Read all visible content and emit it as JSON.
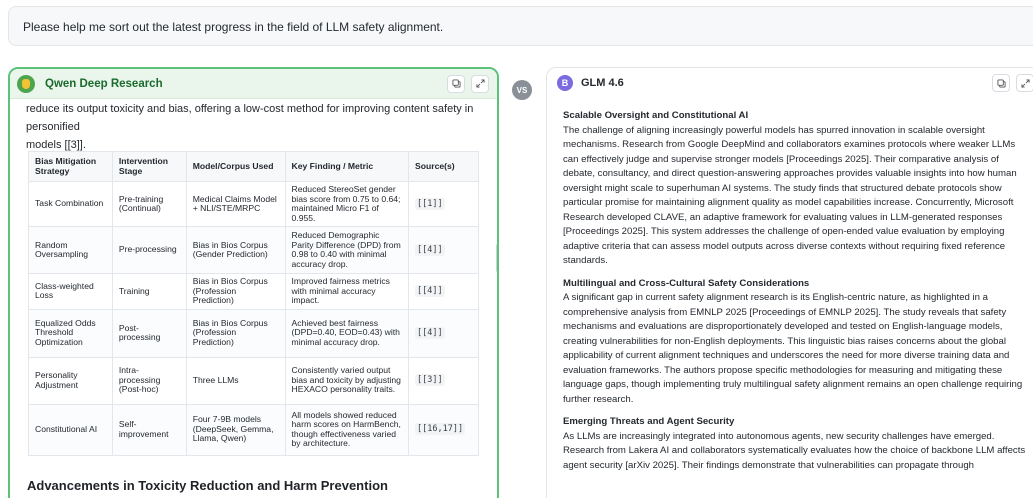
{
  "prompt": "Please help me sort out the latest progress in the field of LLM safety alignment.",
  "left": {
    "title": "Qwen Deep Research",
    "intro_line1": "reduce its output toxicity and bias, offering a low-cost method for improving content safety in personified",
    "intro_line2": "models [[3]].",
    "table": {
      "headers": [
        "Bias Mitigation Strategy",
        "Intervention Stage",
        "Model/Corpus Used",
        "Key Finding / Metric",
        "Source(s)"
      ],
      "rows": [
        [
          "Task Combination",
          "Pre-training (Continual)",
          "Medical Claims Model + NLI/STE/MRPC",
          "Reduced StereoSet gender bias score from 0.75 to 0.64; maintained Micro F1 of 0.955.",
          "[[1]]"
        ],
        [
          "Random Oversampling",
          "Pre-processing",
          "Bias in Bios Corpus (Gender Prediction)",
          "Reduced Demographic Parity Difference (DPD) from 0.98 to 0.40 with minimal accuracy drop.",
          "[[4]]"
        ],
        [
          "Class-weighted Loss",
          "Training",
          "Bias in Bios Corpus (Profession Prediction)",
          "Improved fairness metrics with minimal accuracy impact.",
          "[[4]]"
        ],
        [
          "Equalized Odds Threshold Optimization",
          "Post-processing",
          "Bias in Bios Corpus (Profession Prediction)",
          "Achieved best fairness (DPD=0.40, EOD=0.43) with minimal accuracy drop.",
          "[[4]]"
        ],
        [
          "Personality Adjustment",
          "Intra-processing (Post-hoc)",
          "Three LLMs",
          "Consistently varied output bias and toxicity by adjusting HEXACO personality traits.",
          "[[3]]"
        ],
        [
          "Constitutional AI",
          "Self-improvement",
          "Four 7-9B models (DeepSeek, Gemma, Llama, Qwen)",
          "All models showed reduced harm scores on HarmBench, though effectiveness varied by architecture.",
          "[[16,17]]"
        ]
      ]
    },
    "heading": "Advancements in Toxicity Reduction and Harm Prevention"
  },
  "vs_label": "VS",
  "right": {
    "avatar_letter": "B",
    "title": "GLM 4.6",
    "sections": [
      {
        "heading": "Scalable Oversight and Constitutional AI",
        "body": "The challenge of aligning increasingly powerful models has spurred innovation in scalable oversight mechanisms. Research from Google DeepMind and collaborators examines protocols where weaker LLMs can effectively judge and supervise stronger models [Proceedings 2025]. Their comparative analysis of debate, consultancy, and direct question-answering approaches provides valuable insights into how human oversight might scale to superhuman AI systems. The study finds that structured debate protocols show particular promise for maintaining alignment quality as model capabilities increase. Concurrently, Microsoft Research developed CLAVE, an adaptive framework for evaluating values in LLM-generated responses [Proceedings 2025]. This system addresses the challenge of open-ended value evaluation by employing adaptive criteria that can assess model outputs across diverse contexts without requiring fixed reference standards."
      },
      {
        "heading": "Multilingual and Cross-Cultural Safety Considerations",
        "body": "A significant gap in current safety alignment research is its English-centric nature, as highlighted in a comprehensive analysis from EMNLP 2025 [Proceedings of EMNLP 2025]. The study reveals that safety mechanisms and evaluations are disproportionately developed and tested on English-language models, creating vulnerabilities for non-English deployments. This linguistic bias raises concerns about the global applicability of current alignment techniques and underscores the need for more diverse training data and evaluation frameworks. The authors propose specific methodologies for measuring and mitigating these language gaps, though implementing truly multilingual safety alignment remains an open challenge requiring further research."
      },
      {
        "heading": "Emerging Threats and Agent Security",
        "body": "As LLMs are increasingly integrated into autonomous agents, new security challenges have emerged. Research from Lakera AI and collaborators systematically evaluates how the choice of backbone LLM affects agent security [arXiv 2025]. Their findings demonstrate that vulnerabilities can propagate through"
      }
    ]
  }
}
